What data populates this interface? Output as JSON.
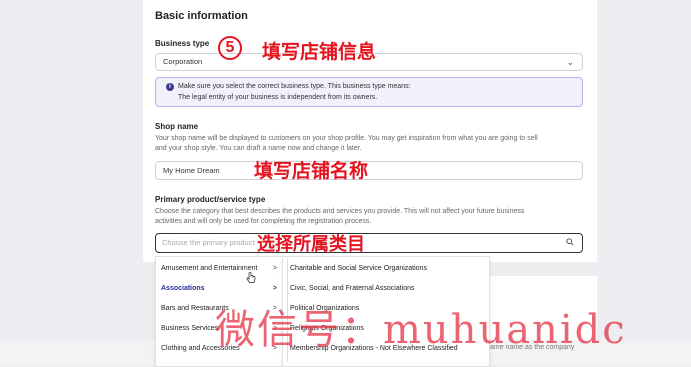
{
  "section_title": "Basic information",
  "business_type": {
    "label": "Business type",
    "value": "Corporation",
    "notice_line1": "Make sure you select the correct business type. This business type means:",
    "notice_line2": "The legal entity of your business is independent from its owners."
  },
  "shop_name": {
    "label": "Shop name",
    "help_line1": "Your shop name will be displayed to customers on your shop profile. You may get inspiration from what you are going to sell",
    "help_line2": "and your shop style. You can draft a name now and change it later.",
    "value": "My Home Dream"
  },
  "primary_product": {
    "label": "Primary product/service type",
    "help_line1": "Choose the category that best describes the products and services you provide. This will not affect your future business",
    "help_line2": "activities and will only be used for completing the registration process.",
    "placeholder": "Choose the primary product"
  },
  "categories": [
    {
      "label": "Amusement and Entertainment",
      "arrow": ">"
    },
    {
      "label": "Associations",
      "arrow": ">"
    },
    {
      "label": "Bars and Restaurants",
      "arrow": ">"
    },
    {
      "label": "Business Services",
      "arrow": ">"
    },
    {
      "label": "Clothing and Accessories",
      "arrow": ">"
    }
  ],
  "subcategories": [
    "Charitable and Social Service Organizations",
    "Civic, Social, and Fraternal Associations",
    "Political Organizations",
    "Religious Organizations",
    "Membership Organizations - Not Elsewhere Classified"
  ],
  "faded_text": "ame name as the company",
  "annotations": {
    "step_number": "5",
    "fill_store_info": "填写店铺信息",
    "fill_store_name": "填写店铺名称",
    "select_category": "选择所属类目",
    "watermark": "微信号：muhuanidc"
  },
  "colors": {
    "annotation_red": "#e4141e",
    "notice_border": "#b6b2e6",
    "active_category": "#2c2ca0"
  }
}
